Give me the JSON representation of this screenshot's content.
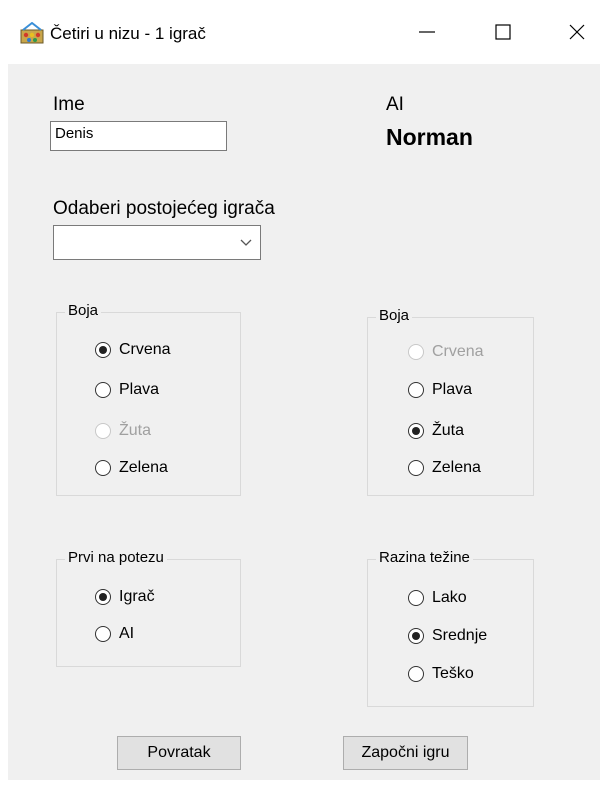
{
  "window": {
    "title": "Četiri u nizu - 1 igrač",
    "icon": "game-app-icon"
  },
  "player": {
    "name_label": "Ime",
    "name_value": "Denis",
    "select_label": "Odaberi postojećeg igrača",
    "select_value": ""
  },
  "ai": {
    "label": "AI",
    "name": "Norman"
  },
  "player_color": {
    "title": "Boja",
    "options": [
      {
        "label": "Crvena",
        "checked": true,
        "enabled": true
      },
      {
        "label": "Plava",
        "checked": false,
        "enabled": true
      },
      {
        "label": "Žuta",
        "checked": false,
        "enabled": false
      },
      {
        "label": "Zelena",
        "checked": false,
        "enabled": true
      }
    ]
  },
  "ai_color": {
    "title": "Boja",
    "options": [
      {
        "label": "Crvena",
        "checked": false,
        "enabled": false
      },
      {
        "label": "Plava",
        "checked": false,
        "enabled": true
      },
      {
        "label": "Žuta",
        "checked": true,
        "enabled": true
      },
      {
        "label": "Zelena",
        "checked": false,
        "enabled": true
      }
    ]
  },
  "first_move": {
    "title": "Prvi na potezu",
    "options": [
      {
        "label": "Igrač",
        "checked": true,
        "enabled": true
      },
      {
        "label": "AI",
        "checked": false,
        "enabled": true
      }
    ]
  },
  "difficulty": {
    "title": "Razina težine",
    "options": [
      {
        "label": "Lako",
        "checked": false,
        "enabled": true
      },
      {
        "label": "Srednje",
        "checked": true,
        "enabled": true
      },
      {
        "label": "Teško",
        "checked": false,
        "enabled": true
      }
    ]
  },
  "buttons": {
    "back": "Povratak",
    "start": "Započni igru"
  }
}
